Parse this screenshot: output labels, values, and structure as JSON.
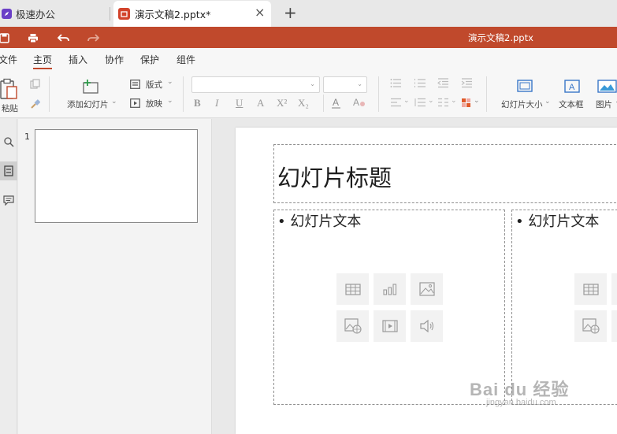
{
  "tabs": {
    "app_name": "极速办公",
    "doc_tab": "演示文稿2.pptx*",
    "close_glyph": "×",
    "new_glyph": "+"
  },
  "titlebar": {
    "title": "演示文稿2.pptx",
    "accent_color": "#c0492c"
  },
  "menu": {
    "items": [
      "文件",
      "主页",
      "插入",
      "协作",
      "保护",
      "组件"
    ],
    "active": "主页"
  },
  "ribbon": {
    "paste_label": "粘贴",
    "add_slide_label": "添加幻灯片",
    "layout_label": "版式",
    "play_label": "放映",
    "slide_size_label": "幻灯片大小",
    "textbox_label": "文本框",
    "image_label": "图片",
    "format_buttons": [
      "B",
      "I",
      "U",
      "A",
      "X²",
      "X₂"
    ],
    "dropdown_glyph": "⌄"
  },
  "thumbnails": {
    "slide_number": "1"
  },
  "slide": {
    "title_placeholder": "幻灯片标题",
    "text_placeholder_left": "• 幻灯片文本",
    "text_placeholder_right": "• 幻灯片文本",
    "insert_icons": [
      "table-icon",
      "chart-icon",
      "image-icon",
      "online-image-icon",
      "video-icon",
      "audio-icon"
    ]
  },
  "watermark": {
    "logo_text": "Bai du 经验",
    "url": "jingyan.baidu.com"
  }
}
